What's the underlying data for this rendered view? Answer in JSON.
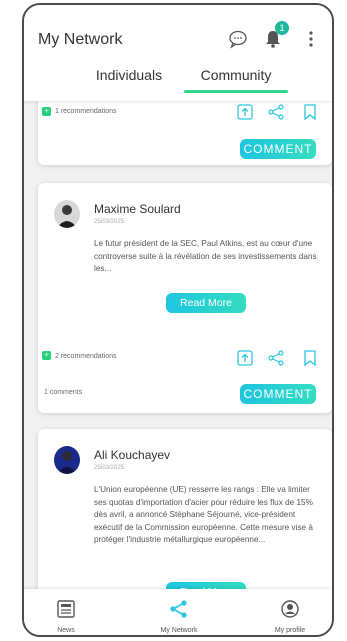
{
  "header": {
    "title": "My Network",
    "notification_count": "1"
  },
  "tabs": [
    {
      "label": "Individuals",
      "active": false
    },
    {
      "label": "Community",
      "active": true
    }
  ],
  "accent_color": "#2fd58a",
  "cards": [
    {
      "recommendations": "1 recommendations",
      "comment_label": "COMMENT"
    },
    {
      "author": "Maxime Soulard",
      "date": "25/03/2025",
      "text": "Le futur président de la SEC, Paul Atkins, est au cœur d'une controverse suite à la révélation de ses investissements dans les...",
      "read_more": "Read More",
      "recommendations": "2 recommendations",
      "comments": "1 comments",
      "comment_label": "COMMENT"
    },
    {
      "author": "Ali Kouchayev",
      "date": "25/03/2025",
      "text": "L'Union européenne (UE) resserre les rangs : Elle va limiter ses quotas d'importation d'acier pour réduire les flux de 15% dès avril, a annoncé Stéphane Séjourné, vice-président exécutif de la Commission européenne. Cette mesure vise à protéger l'industrie métallurgique européenne...",
      "read_more": "Read More"
    }
  ],
  "bottom_nav": [
    {
      "label": "News",
      "icon": "news-icon"
    },
    {
      "label": "My Network",
      "icon": "share-icon"
    },
    {
      "label": "My profile",
      "icon": "profile-icon"
    }
  ]
}
